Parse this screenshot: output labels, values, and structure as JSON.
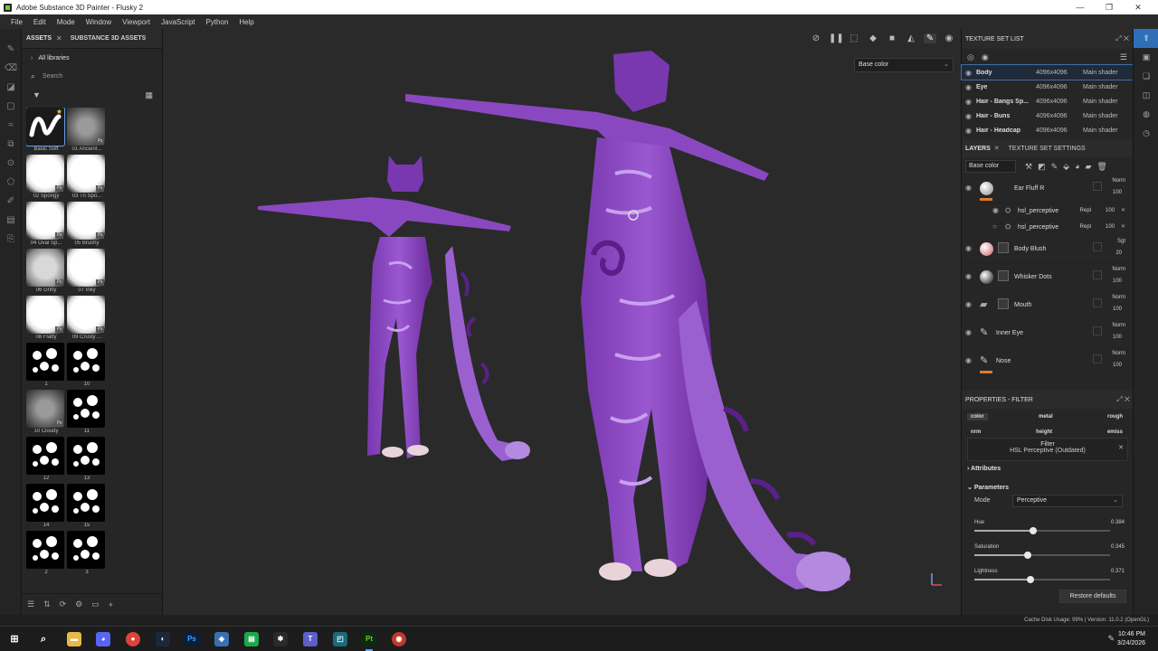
{
  "window": {
    "title": "Adobe Substance 3D Painter - Flusky 2",
    "controls": [
      "—",
      "❐",
      "✕"
    ]
  },
  "menu": [
    "File",
    "Edit",
    "Mode",
    "Window",
    "Viewport",
    "JavaScript",
    "Python",
    "Help"
  ],
  "assets_panel": {
    "tab_assets": "ASSETS",
    "tab_close": "✕",
    "tab_s3d": "SUBSTANCE 3D ASSETS",
    "library": "All libraries",
    "search_placeholder": "Search",
    "brushes": [
      {
        "label": "Basic Soft",
        "style": "soft-curve",
        "ps": false,
        "selected": true
      },
      {
        "label": "01 Ancient...",
        "style": "grey",
        "ps": true
      },
      {
        "label": "02 Spongy",
        "style": "white",
        "ps": true
      },
      {
        "label": "03 Tri Spo...",
        "style": "white",
        "ps": true
      },
      {
        "label": "04 Oval Sp...",
        "style": "white",
        "ps": true
      },
      {
        "label": "05 Brushy",
        "style": "white",
        "ps": true
      },
      {
        "label": "06 Gritty",
        "style": "light",
        "ps": true
      },
      {
        "label": "07 Inky",
        "style": "white",
        "ps": true
      },
      {
        "label": "08 Flatty",
        "style": "white",
        "ps": true
      },
      {
        "label": "09 Crusty ...",
        "style": "white",
        "ps": true
      },
      {
        "label": "1",
        "style": "dots",
        "ps": false
      },
      {
        "label": "10",
        "style": "dots",
        "ps": false
      },
      {
        "label": "10 Cloudy",
        "style": "grey",
        "ps": true
      },
      {
        "label": "11",
        "style": "dots",
        "ps": false
      },
      {
        "label": "12",
        "style": "dots",
        "ps": false
      },
      {
        "label": "13",
        "style": "dots",
        "ps": false
      },
      {
        "label": "14",
        "style": "dots",
        "ps": false
      },
      {
        "label": "15",
        "style": "dots",
        "ps": false
      },
      {
        "label": "2",
        "style": "dots",
        "ps": false
      },
      {
        "label": "3",
        "style": "dots",
        "ps": false
      }
    ]
  },
  "viewport": {
    "channel_select": "Base color"
  },
  "texture_set_list": {
    "title": "TEXTURE SET LIST",
    "rows": [
      {
        "name": "Body",
        "res": "4096x4096",
        "shader": "Main shader",
        "selected": true
      },
      {
        "name": "Eye",
        "res": "4096x4096",
        "shader": "Main shader"
      },
      {
        "name": "Hair - Bangs Sp...",
        "res": "4096x4096",
        "shader": "Main shader"
      },
      {
        "name": "Hair - Buns",
        "res": "4096x4096",
        "shader": "Main shader"
      },
      {
        "name": "Hair - Headcap",
        "res": "4096x4096",
        "shader": "Main shader"
      }
    ]
  },
  "layers": {
    "tab_layers": "LAYERS",
    "tab_close": "✕",
    "tab_tss": "TEXTURE SET SETTINGS",
    "channel_combo": "Base color",
    "items": [
      {
        "name": "Ear Fluff R",
        "blend": "Norm",
        "opacity": "100",
        "thumb": "#888888",
        "orange": true,
        "kind": "layer"
      },
      {
        "name": "hsl_perceptive",
        "blend": "Repl",
        "opacity": "100",
        "kind": "sub",
        "visible": true
      },
      {
        "name": "hsl_perceptive",
        "blend": "Repl",
        "opacity": "100",
        "kind": "sub",
        "visible": false
      },
      {
        "name": "Body Blush",
        "blend": "Sgt",
        "opacity": "20",
        "thumb": "#d06060",
        "kind": "layer"
      },
      {
        "name": "Whisker Dots",
        "blend": "Norm",
        "opacity": "100",
        "thumb": "#111111",
        "kind": "layer"
      },
      {
        "name": "Mouth",
        "blend": "Norm",
        "opacity": "100",
        "kind": "folder"
      },
      {
        "name": "Inner Eye",
        "blend": "Norm",
        "opacity": "100",
        "kind": "paint"
      },
      {
        "name": "Nose",
        "blend": "Norm",
        "opacity": "100",
        "kind": "paint",
        "orange": true
      }
    ]
  },
  "properties": {
    "title": "PROPERTIES - FILTER",
    "channels_row1": [
      "color",
      "metal",
      "rough"
    ],
    "channels_row2": [
      "nrm",
      "height",
      "emiss"
    ],
    "filter_label": "Filter",
    "filter_name": "HSL Perceptive (Outdated)",
    "attributes": "Attributes",
    "parameters": "Parameters",
    "mode_label": "Mode",
    "mode_value": "Perceptive",
    "params": [
      {
        "label": "Hue",
        "value": "0.384",
        "frac": 0.43
      },
      {
        "label": "Saturation",
        "value": "0.345",
        "frac": 0.39
      },
      {
        "label": "Lightness",
        "value": "0.371",
        "frac": 0.41
      }
    ],
    "restore": "Restore defaults"
  },
  "status": {
    "text": "Cache Disk Usage:   99% | Version: 11.0.2 (OpenGL)"
  },
  "taskbar": {
    "time": "10:46 PM",
    "date": "3/24/2026"
  },
  "colors": {
    "accent": "#2f6fb8",
    "purple_dark": "#6a2a9a",
    "purple_light": "#a070d8",
    "orange": "#e07a2c"
  }
}
